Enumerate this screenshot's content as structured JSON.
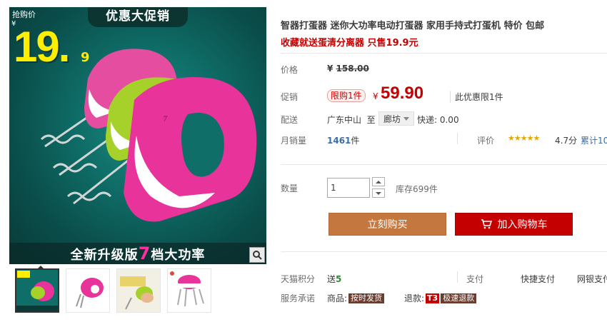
{
  "gallery": {
    "badge": "抢购价",
    "banner_top": "优惠大促销",
    "yen": "¥",
    "big_price": "19.",
    "big_price_sub": "9",
    "banner_bottom_pre": "全新升级版",
    "banner_bottom_hl": "7",
    "banner_bottom_post": "档大功率",
    "thumbs": [
      "thumb-1",
      "thumb-2",
      "thumb-3",
      "thumb-4"
    ]
  },
  "product": {
    "title": "智器打蛋器 迷你大功率电动打蛋器 家用手持式打蛋机 特价 包邮",
    "subtitle": "收藏就送蛋清分离器 只售19.9元"
  },
  "price": {
    "label": "价格",
    "yen": "¥",
    "original": "158.00",
    "promo_label": "促销",
    "limit_tag": "限购1件",
    "promo_yen": "¥",
    "promo_value": "59.90",
    "promo_note": "此优惠限1件"
  },
  "shipping": {
    "label": "配送",
    "from": "广东中山",
    "to_label": "至",
    "to": "廊坊",
    "fee": "快递: 0.00"
  },
  "sales": {
    "label": "月销量",
    "count": "1461",
    "unit": "件",
    "rating_label": "评价",
    "stars": "★★★★★",
    "score": "4.7分",
    "count_text": "累计10"
  },
  "quantity": {
    "label": "数量",
    "value": "1",
    "stock": "库存699件"
  },
  "actions": {
    "buy_now": "立刻购买",
    "add_cart": "加入购物车"
  },
  "extras": {
    "points_label": "天猫积分",
    "points_pre": "送",
    "points_value": "5",
    "pay1": "支付",
    "pay2": "快捷支付",
    "pay3": "网银支付",
    "service_label": "服务承诺",
    "goods_label": "商品:",
    "goods_tag": "按时发货",
    "refund_label": "退款:",
    "refund_t3": "T3",
    "refund_tag": "极速退款"
  },
  "colors": {
    "accent_red": "#c40000",
    "buy_orange": "#c4773e",
    "link_blue": "#3a6ea5",
    "star_gold": "#e4a800"
  }
}
